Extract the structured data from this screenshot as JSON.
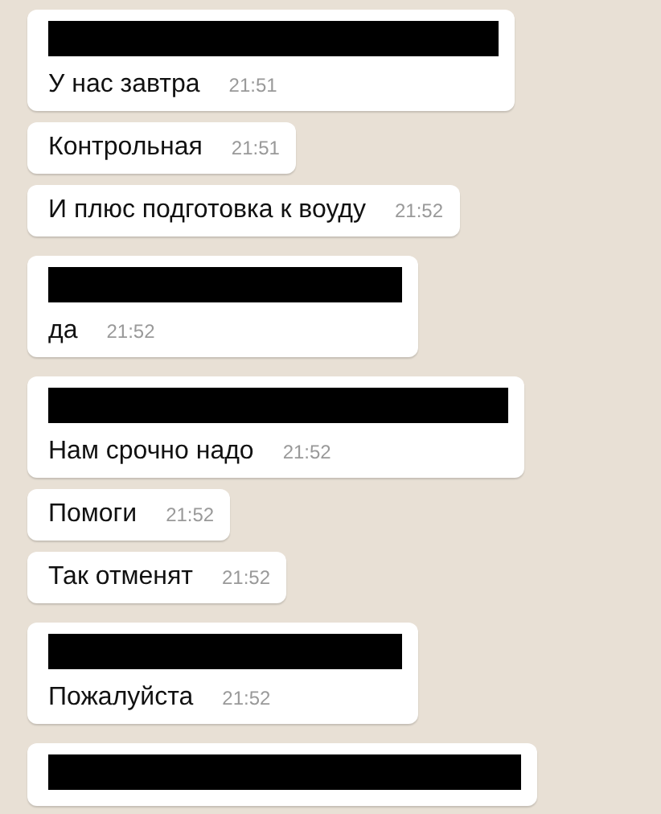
{
  "chat": {
    "groups": [
      {
        "sender_redacted": true,
        "messages": [
          {
            "text": "У нас завтра",
            "time": "21:51"
          },
          {
            "text": "Контрольная",
            "time": "21:51"
          },
          {
            "text": "И плюс подготовка к воуду",
            "time": "21:52"
          }
        ]
      },
      {
        "sender_redacted": true,
        "messages": [
          {
            "text": "да",
            "time": "21:52"
          }
        ]
      },
      {
        "sender_redacted": true,
        "messages": [
          {
            "text": "Нам срочно надо",
            "time": "21:52"
          },
          {
            "text": "Помоги",
            "time": "21:52"
          },
          {
            "text": "Так отменят",
            "time": "21:52"
          }
        ]
      },
      {
        "sender_redacted": true,
        "messages": [
          {
            "text": "Пожалуйста",
            "time": "21:52"
          }
        ]
      },
      {
        "sender_redacted": true
      }
    ]
  }
}
